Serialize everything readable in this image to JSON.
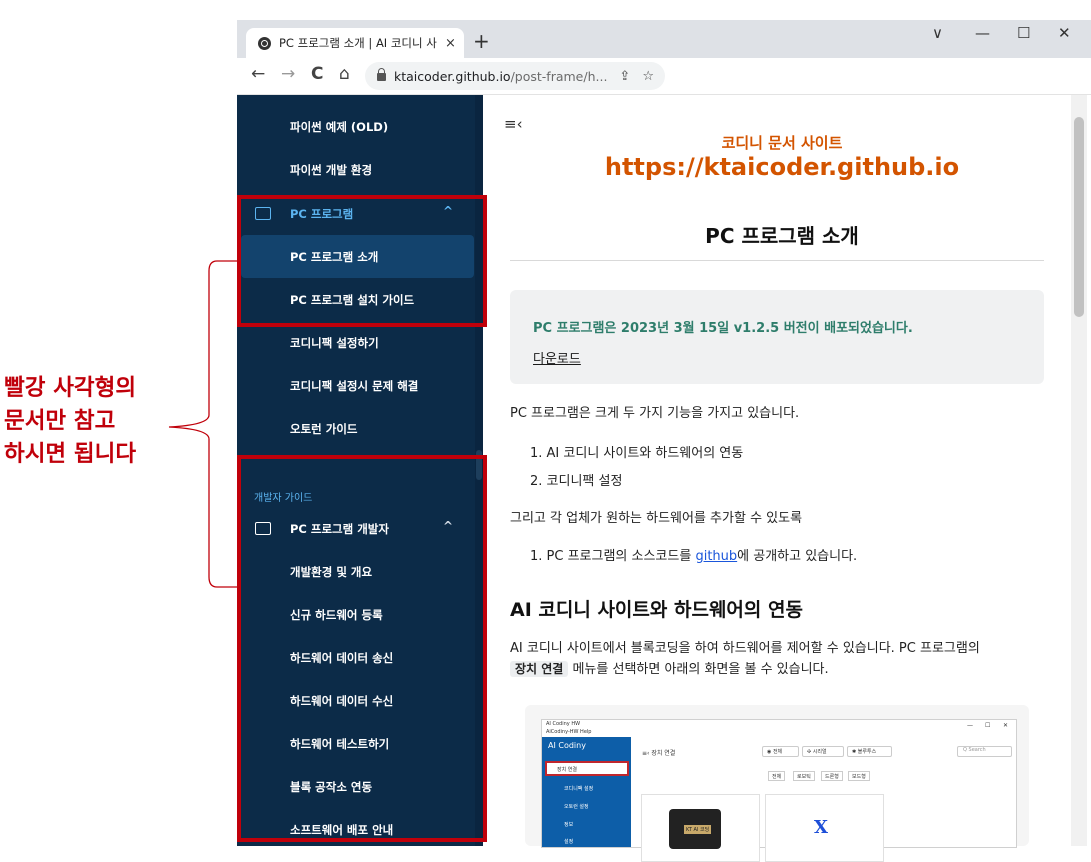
{
  "browser": {
    "tab_title": "PC 프로그램 소개 | AI 코디니 사",
    "tab_close": "×",
    "new_tab": "+",
    "win_min": "—",
    "win_max": "☐",
    "win_close": "✕",
    "win_dropdown": "∨",
    "nav_back": "←",
    "nav_forward": "→",
    "nav_reload": "C",
    "nav_home": "⌂",
    "url_host": "ktaicoder.github.io",
    "url_path": "/post-frame/h...",
    "share_icon": "⇪",
    "star_icon": "☆"
  },
  "sidebar": {
    "items": [
      {
        "label": "파이썬 예제 (OLD)"
      },
      {
        "label": "파이썬 개발 환경"
      },
      {
        "label": "PC 프로그램"
      },
      {
        "label": "PC 프로그램 소개"
      },
      {
        "label": "PC 프로그램 설치 가이드"
      },
      {
        "label": "코디니팩 설정하기"
      },
      {
        "label": "코디니팩 설정시 문제 해결"
      },
      {
        "label": "오토런 가이드"
      },
      {
        "label": "PC 프로그램 개발자"
      },
      {
        "label": "개발환경 및 개요"
      },
      {
        "label": "신규 하드웨어 등록"
      },
      {
        "label": "하드웨어 데이터 송신"
      },
      {
        "label": "하드웨어 데이터 수신"
      },
      {
        "label": "하드웨어 테스트하기"
      },
      {
        "label": "블록 공작소 연동"
      },
      {
        "label": "소프트웨어 배포 안내"
      }
    ],
    "section_label": "개발자 가이드",
    "chevron": "^"
  },
  "main": {
    "menu_toggle": "≡‹",
    "brand_sub": "코디니 문서 사이트",
    "brand_url": "https://ktaicoder.github.io",
    "title": "PC 프로그램 소개",
    "notice_text": "PC 프로그램은 2023년 3월 15일 v1.2.5 버전이 배포되었습니다.",
    "notice_link": "다운로드",
    "intro": "PC 프로그램은 크게 두 가지 기능을 가지고 있습니다.",
    "features": [
      "1. AI 코디니 사이트와 하드웨어의 연동",
      "2. 코디니팩 설정"
    ],
    "para2": "그리고 각 업체가 원하는 하드웨어를 추가할 수 있도록",
    "list2_prefix": "1. PC 프로그램의 소스코드를 ",
    "list2_link": "github",
    "list2_suffix": "에 공개하고 있습니다.",
    "h2": "AI 코디니 사이트와 하드웨어의 연동",
    "para3_line1": "AI 코디니 사이트에서 블록코딩을 하여 하드웨어를 제어할 수 있습니다. PC 프로그램의",
    "para3_kbd": "장치 연결",
    "para3_line2": " 메뉴를 선택하면 아래의 화면을 볼 수 있습니다."
  },
  "embedded_app": {
    "title": "AI Codiny HW",
    "menu": "AiCodiny-HW   Help",
    "brand": "AI Codiny",
    "win_controls": [
      "—",
      "☐",
      "✕"
    ],
    "side_items": [
      "장치 연결",
      "코디니팩 설정",
      "오토런 설정",
      "정보",
      "설정"
    ],
    "header": "≡‹   장치 연결",
    "filters": [
      "◉ 전체",
      "✣ 시리얼",
      "✱ 블루투스"
    ],
    "search_placeholder": "Q  Search",
    "categories": [
      "전체",
      "로보틱",
      "드론형",
      "보드형"
    ],
    "device1_label": "KT AI 코딩"
  },
  "annotation": {
    "caption_lines": [
      "빨강 사각형의",
      "문서만 참고",
      "하시면 됩니다"
    ]
  }
}
